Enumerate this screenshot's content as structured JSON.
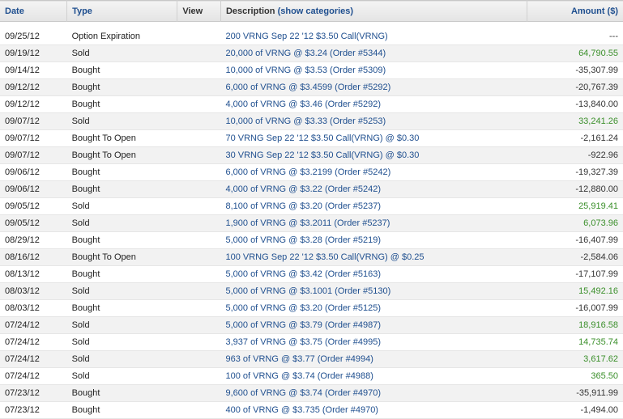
{
  "headers": {
    "date": "Date",
    "type": "Type",
    "view": "View",
    "description": "Description",
    "show_categories": "(show categories)",
    "amount": "Amount ($)"
  },
  "rows": [
    {
      "date": "09/25/12",
      "type": "Option Expiration",
      "description": "200 VRNG Sep 22 '12 $3.50 Call(VRNG)",
      "amount": "---",
      "sign": "neg"
    },
    {
      "date": "09/19/12",
      "type": "Sold",
      "description": "20,000 of VRNG @ $3.24 (Order #5344)",
      "amount": "64,790.55",
      "sign": "pos"
    },
    {
      "date": "09/14/12",
      "type": "Bought",
      "description": "10,000 of VRNG @ $3.53 (Order #5309)",
      "amount": "-35,307.99",
      "sign": "neg"
    },
    {
      "date": "09/12/12",
      "type": "Bought",
      "description": "6,000 of VRNG @ $3.4599 (Order #5292)",
      "amount": "-20,767.39",
      "sign": "neg"
    },
    {
      "date": "09/12/12",
      "type": "Bought",
      "description": "4,000 of VRNG @ $3.46 (Order #5292)",
      "amount": "-13,840.00",
      "sign": "neg"
    },
    {
      "date": "09/07/12",
      "type": "Sold",
      "description": "10,000 of VRNG @ $3.33 (Order #5253)",
      "amount": "33,241.26",
      "sign": "pos"
    },
    {
      "date": "09/07/12",
      "type": "Bought To Open",
      "description": "70 VRNG Sep 22 '12 $3.50 Call(VRNG) @ $0.30",
      "amount": "-2,161.24",
      "sign": "neg"
    },
    {
      "date": "09/07/12",
      "type": "Bought To Open",
      "description": "30 VRNG Sep 22 '12 $3.50 Call(VRNG) @ $0.30",
      "amount": "-922.96",
      "sign": "neg"
    },
    {
      "date": "09/06/12",
      "type": "Bought",
      "description": "6,000 of VRNG @ $3.2199 (Order #5242)",
      "amount": "-19,327.39",
      "sign": "neg"
    },
    {
      "date": "09/06/12",
      "type": "Bought",
      "description": "4,000 of VRNG @ $3.22 (Order #5242)",
      "amount": "-12,880.00",
      "sign": "neg"
    },
    {
      "date": "09/05/12",
      "type": "Sold",
      "description": "8,100 of VRNG @ $3.20 (Order #5237)",
      "amount": "25,919.41",
      "sign": "pos"
    },
    {
      "date": "09/05/12",
      "type": "Sold",
      "description": "1,900 of VRNG @ $3.2011 (Order #5237)",
      "amount": "6,073.96",
      "sign": "pos"
    },
    {
      "date": "08/29/12",
      "type": "Bought",
      "description": "5,000 of VRNG @ $3.28 (Order #5219)",
      "amount": "-16,407.99",
      "sign": "neg"
    },
    {
      "date": "08/16/12",
      "type": "Bought To Open",
      "description": "100 VRNG Sep 22 '12 $3.50 Call(VRNG) @ $0.25",
      "amount": "-2,584.06",
      "sign": "neg"
    },
    {
      "date": "08/13/12",
      "type": "Bought",
      "description": "5,000 of VRNG @ $3.42 (Order #5163)",
      "amount": "-17,107.99",
      "sign": "neg"
    },
    {
      "date": "08/03/12",
      "type": "Sold",
      "description": "5,000 of VRNG @ $3.1001 (Order #5130)",
      "amount": "15,492.16",
      "sign": "pos"
    },
    {
      "date": "08/03/12",
      "type": "Bought",
      "description": "5,000 of VRNG @ $3.20 (Order #5125)",
      "amount": "-16,007.99",
      "sign": "neg"
    },
    {
      "date": "07/24/12",
      "type": "Sold",
      "description": "5,000 of VRNG @ $3.79 (Order #4987)",
      "amount": "18,916.58",
      "sign": "pos"
    },
    {
      "date": "07/24/12",
      "type": "Sold",
      "description": "3,937 of VRNG @ $3.75 (Order #4995)",
      "amount": "14,735.74",
      "sign": "pos"
    },
    {
      "date": "07/24/12",
      "type": "Sold",
      "description": "963 of VRNG @ $3.77 (Order #4994)",
      "amount": "3,617.62",
      "sign": "pos"
    },
    {
      "date": "07/24/12",
      "type": "Sold",
      "description": "100 of VRNG @ $3.74 (Order #4988)",
      "amount": "365.50",
      "sign": "pos"
    },
    {
      "date": "07/23/12",
      "type": "Bought",
      "description": "9,600 of VRNG @ $3.74 (Order #4970)",
      "amount": "-35,911.99",
      "sign": "neg"
    },
    {
      "date": "07/23/12",
      "type": "Bought",
      "description": "400 of VRNG @ $3.735 (Order #4970)",
      "amount": "-1,494.00",
      "sign": "neg"
    }
  ],
  "colors": {
    "positive": "#3a8f2a",
    "link": "#1f4f8f"
  }
}
